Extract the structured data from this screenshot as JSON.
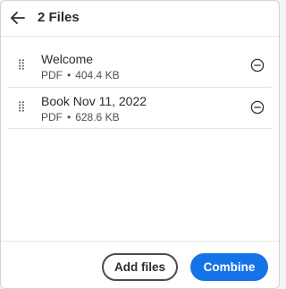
{
  "header": {
    "title": "2 Files"
  },
  "files": [
    {
      "name": "Welcome",
      "type": "PDF",
      "separator": "•",
      "size": "404.4 KB"
    },
    {
      "name": "Book Nov 11, 2022",
      "type": "PDF",
      "separator": "•",
      "size": "628.6 KB"
    }
  ],
  "footer": {
    "add_label": "Add files",
    "combine_label": "Combine"
  },
  "icons": {
    "back": "arrow-left-icon",
    "grip": "drag-handle-icon",
    "remove": "minus-circle-icon"
  },
  "colors": {
    "accent": "#1473e6",
    "text": "#2c2c2c",
    "muted": "#505050"
  }
}
